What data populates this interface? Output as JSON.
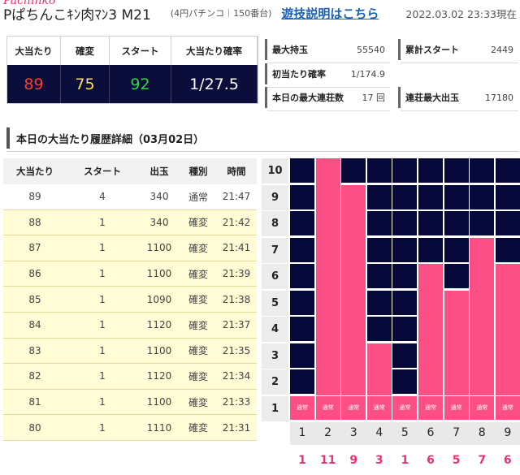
{
  "header": {
    "logo": "Pachinko",
    "machine_name": "Pぱちんこｷﾝ肉ﾏﾝ3 M21",
    "machine_meta": "(4円パチンコ｜150番台)",
    "link": "遊技説明はこちら",
    "updated": "2022.03.02 23:33現在"
  },
  "summary": {
    "headers": [
      "大当たり",
      "確変",
      "スタート",
      "大当たり確率"
    ],
    "values": [
      "89",
      "75",
      "92",
      "1/27.5"
    ],
    "colors": [
      "#ff3b30",
      "#ffe14a",
      "#36d24a",
      "#ffffff"
    ]
  },
  "stats": [
    {
      "label": "最大持玉",
      "value": "55540"
    },
    {
      "label": "累計スタート",
      "value": "2449"
    },
    {
      "label": "初当たり確率",
      "value": "1/174.9"
    },
    {
      "label": "本日の最大連荘数",
      "value": "17 回"
    },
    {
      "label": "連荘最大出玉",
      "value": "17180"
    }
  ],
  "section_title": "本日の大当たり履歴詳細（03月02日）",
  "history": {
    "headers": [
      "大当たり",
      "スタート",
      "出玉",
      "種別",
      "時間"
    ],
    "rows": [
      {
        "no": "89",
        "start": "4",
        "out": "340",
        "type": "通常",
        "time": "21:47"
      },
      {
        "no": "88",
        "start": "1",
        "out": "340",
        "type": "確変",
        "time": "21:42"
      },
      {
        "no": "87",
        "start": "1",
        "out": "1100",
        "type": "確変",
        "time": "21:41"
      },
      {
        "no": "86",
        "start": "1",
        "out": "1100",
        "type": "確変",
        "time": "21:39"
      },
      {
        "no": "85",
        "start": "1",
        "out": "1090",
        "type": "確変",
        "time": "21:38"
      },
      {
        "no": "84",
        "start": "1",
        "out": "1120",
        "type": "確変",
        "time": "21:37"
      },
      {
        "no": "83",
        "start": "1",
        "out": "1100",
        "type": "確変",
        "time": "21:35"
      },
      {
        "no": "82",
        "start": "1",
        "out": "1120",
        "type": "確変",
        "time": "21:34"
      },
      {
        "no": "81",
        "start": "1",
        "out": "1100",
        "type": "確変",
        "time": "21:33"
      },
      {
        "no": "80",
        "start": "1",
        "out": "1110",
        "type": "確変",
        "time": "21:31"
      }
    ]
  },
  "chart_data": {
    "type": "bar",
    "y_levels": [
      "10",
      "9",
      "8",
      "7",
      "6",
      "5",
      "4",
      "3",
      "2",
      "1"
    ],
    "ylim": [
      0,
      10
    ],
    "categories": [
      "1",
      "2",
      "3",
      "4",
      "5",
      "6",
      "7",
      "8",
      "9"
    ],
    "values": [
      1,
      11,
      9,
      3,
      1,
      6,
      5,
      7,
      6
    ],
    "tags": [
      "通常",
      "通常",
      "通常",
      "通常",
      "通常",
      "通常",
      "通常",
      "通常",
      "通常"
    ],
    "bar_color": "#fb4f86",
    "background_color": "#050838"
  }
}
